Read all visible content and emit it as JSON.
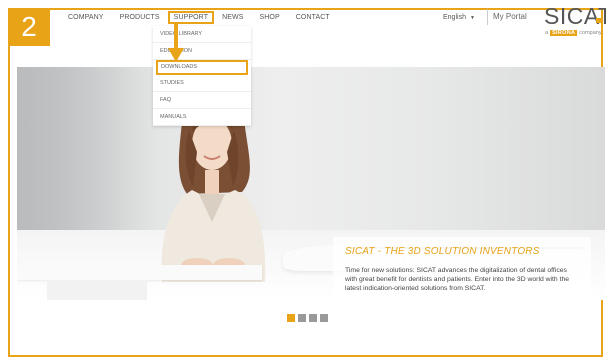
{
  "step_badge": "2",
  "nav": {
    "items": [
      {
        "label": "COMPANY"
      },
      {
        "label": "PRODUCTS"
      },
      {
        "label": "SUPPORT"
      },
      {
        "label": "NEWS"
      },
      {
        "label": "SHOP"
      },
      {
        "label": "CONTACT"
      }
    ],
    "active": "SUPPORT"
  },
  "header": {
    "language": "English",
    "portal": "My Portal",
    "logo": "SICAT",
    "tagline_prefix": "a",
    "tagline_brand": "SIRONA",
    "tagline_suffix": "company"
  },
  "dropdown": {
    "items": [
      {
        "label": "VIDEO LIBRARY"
      },
      {
        "label": "EDUCATION"
      },
      {
        "label": "DOWNLOADS"
      },
      {
        "label": "STUDIES"
      },
      {
        "label": "FAQ"
      },
      {
        "label": "MANUALS"
      }
    ],
    "highlighted": "DOWNLOADS"
  },
  "hero": {
    "title": "SICAT - THE 3D SOLUTION INVENTORS",
    "text": "Time for new solutions: SICAT advances the digitalization of dental offices with great benefit for dentists and patients. Enter into the 3D world with the latest indication-oriented solutions from SICAT."
  },
  "slider": {
    "count": 4,
    "active_index": 0
  },
  "colors": {
    "accent": "#e8a317",
    "text": "#555555",
    "dot_inactive": "#999999"
  }
}
